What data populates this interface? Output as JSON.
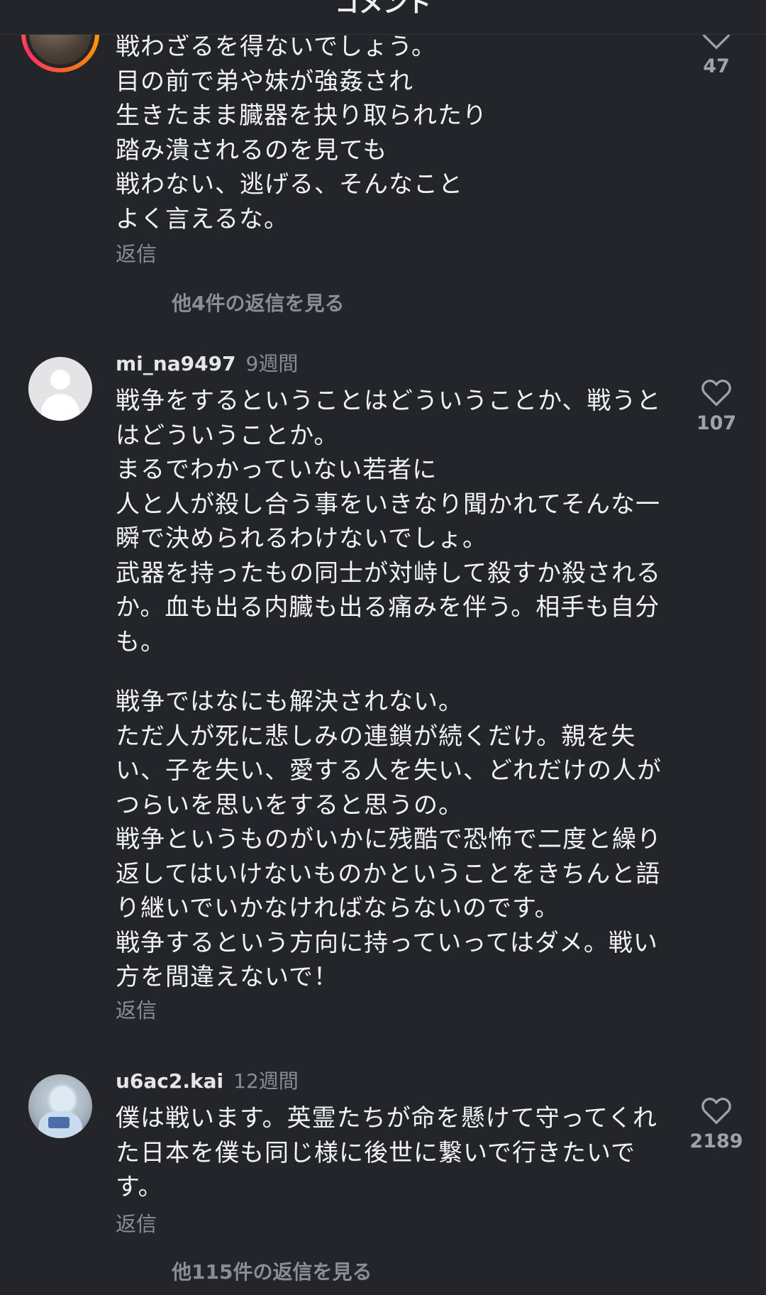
{
  "header": {
    "title": "コメント"
  },
  "comments": [
    {
      "username": "",
      "age": "",
      "lines": [
        "戦わざるを得ないでしょう。",
        "目の前で弟や妹が強姦され",
        "生きたまま臓器を抉り取られたり",
        "踏み潰されるのを見ても",
        "戦わない、逃げる、そんなこと",
        "よく言えるな。"
      ],
      "reply_label": "返信",
      "likes": "47",
      "more_replies": "他4件の返信を見る"
    },
    {
      "username": "mi_na9497",
      "age": "9週間",
      "lines": [
        "戦争をするということはどういうことか、戦うと",
        "はどういうことか。",
        "まるでわかっていない若者に",
        "人と人が殺し合う事をいきなり聞かれてそんな一",
        "瞬で決められるわけないでしょ。",
        "武器を持ったもの同士が対峙して殺すか殺される",
        "か。血も出る内臓も出る痛みを伴う。相手も自分",
        "も。",
        "",
        "戦争ではなにも解決されない。",
        "ただ人が死に悲しみの連鎖が続くだけ。親を失",
        "い、子を失い、愛する人を失い、どれだけの人が",
        "つらいを思いをすると思うの。",
        "戦争というものがいかに残酷で恐怖で二度と繰り",
        "返してはいけないものかということをきちんと語",
        "り継いでいかなければならないのです。",
        "戦争するという方向に持っていってはダメ。戦い",
        "方を間違えないで！"
      ],
      "reply_label": "返信",
      "likes": "107"
    },
    {
      "username": "u6ac2.kai",
      "age": "12週間",
      "lines": [
        "僕は戦います。英霊たちが命を懸けて守ってくれ",
        "た日本を僕も同じ様に後世に繋いで行きたいで",
        "す。"
      ],
      "reply_label": "返信",
      "likes": "2189",
      "more_replies": "他115件の返信を見る"
    }
  ],
  "icons": {
    "like": "heart-outline-icon"
  },
  "colors": {
    "background": "#24252a",
    "text": "#f2f2f2",
    "muted": "#8b8d93"
  }
}
